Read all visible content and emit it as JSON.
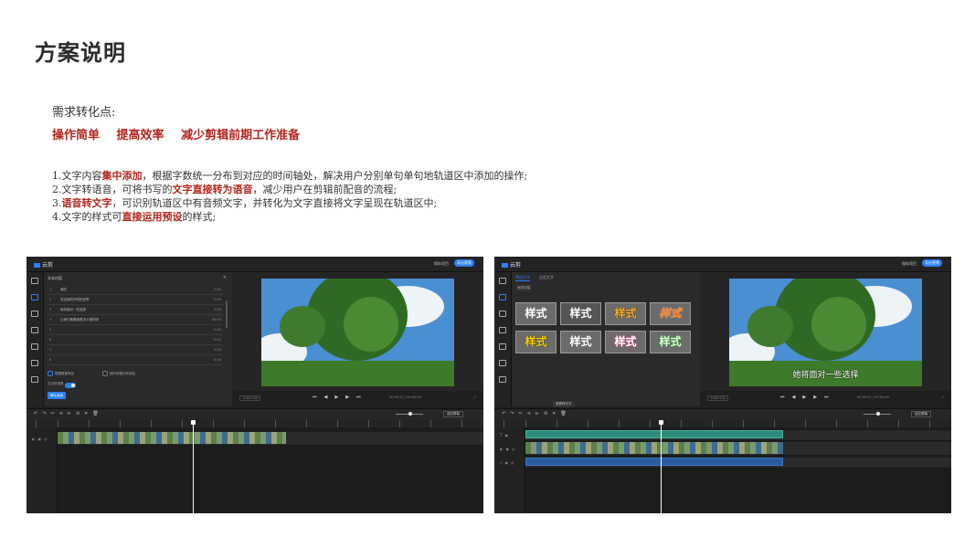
{
  "title": "方案说明",
  "needs_label": "需求转化点:",
  "keywords": [
    "操作简单",
    "提高效率",
    "减少剪辑前期工作准备"
  ],
  "descriptions": [
    {
      "pre": "1.文字内容",
      "hl": "集中添加",
      "post": "，根据字数统一分布到对应的时间轴处，解决用户分别单句单句地轨道区中添加的操作;"
    },
    {
      "pre": "2.文字转语音，可将书写的",
      "hl": "文字直接转为语音",
      "post": "，减少用户在剪辑前配音的流程;"
    },
    {
      "pre": "3.",
      "hl": "语音转文字",
      "post": "，可识别轨道区中有音频文字，并转化为文字直接将文字呈现在轨道区中;"
    },
    {
      "pre": "4.文字的样式可",
      "hl": "直接运用预设",
      "post": "的样式;"
    }
  ],
  "left_shot": {
    "panel_title": "文本内容",
    "rows": [
      {
        "n": "1",
        "text": "我的",
        "dur": "0:00"
      },
      {
        "n": "2",
        "text": "说这前的不同的世界",
        "dur": "0:00"
      },
      {
        "n": "3",
        "text": "她将面对一些选择",
        "dur": "0:00"
      },
      {
        "n": "4",
        "text": "让我们看看她是怎么做的呢",
        "dur": "00:00"
      },
      {
        "n": "5",
        "text": "",
        "dur": "0:00"
      },
      {
        "n": "6",
        "text": "",
        "dur": "0:00"
      },
      {
        "n": "7",
        "text": "",
        "dur": "0:00"
      },
      {
        "n": "8",
        "text": "",
        "dur": "0:00"
      }
    ],
    "opt1": "根据数据添加",
    "opt2": "按时间轴分布添加",
    "opt3": "文字转语音",
    "confirm": "确认添加",
    "resolution": "1280*720",
    "time": "00:00:22 / 00:00:00"
  },
  "right_shot": {
    "tab_active": "预设文字",
    "tab_other": "自定文字",
    "add_btn": "添加字幕",
    "tile_text": "样式",
    "subtitle": "她将面对一些选择",
    "tooltip": "语音转文字",
    "resolution": "1280*720",
    "time": "00:00:22 / 00:00:00"
  },
  "top_export": "导出视频",
  "top_publish": "保存项目",
  "logo_text": "云剪",
  "fit_label": "适应屏幕",
  "style_colors": {
    "white": "#ffffff",
    "yellow": "#ffd400",
    "orange": "#ff7a1a",
    "pink": "#ff5aa0",
    "green": "#9be77a",
    "accent_red": "#b3261e",
    "blue": "#2d7ff9"
  }
}
